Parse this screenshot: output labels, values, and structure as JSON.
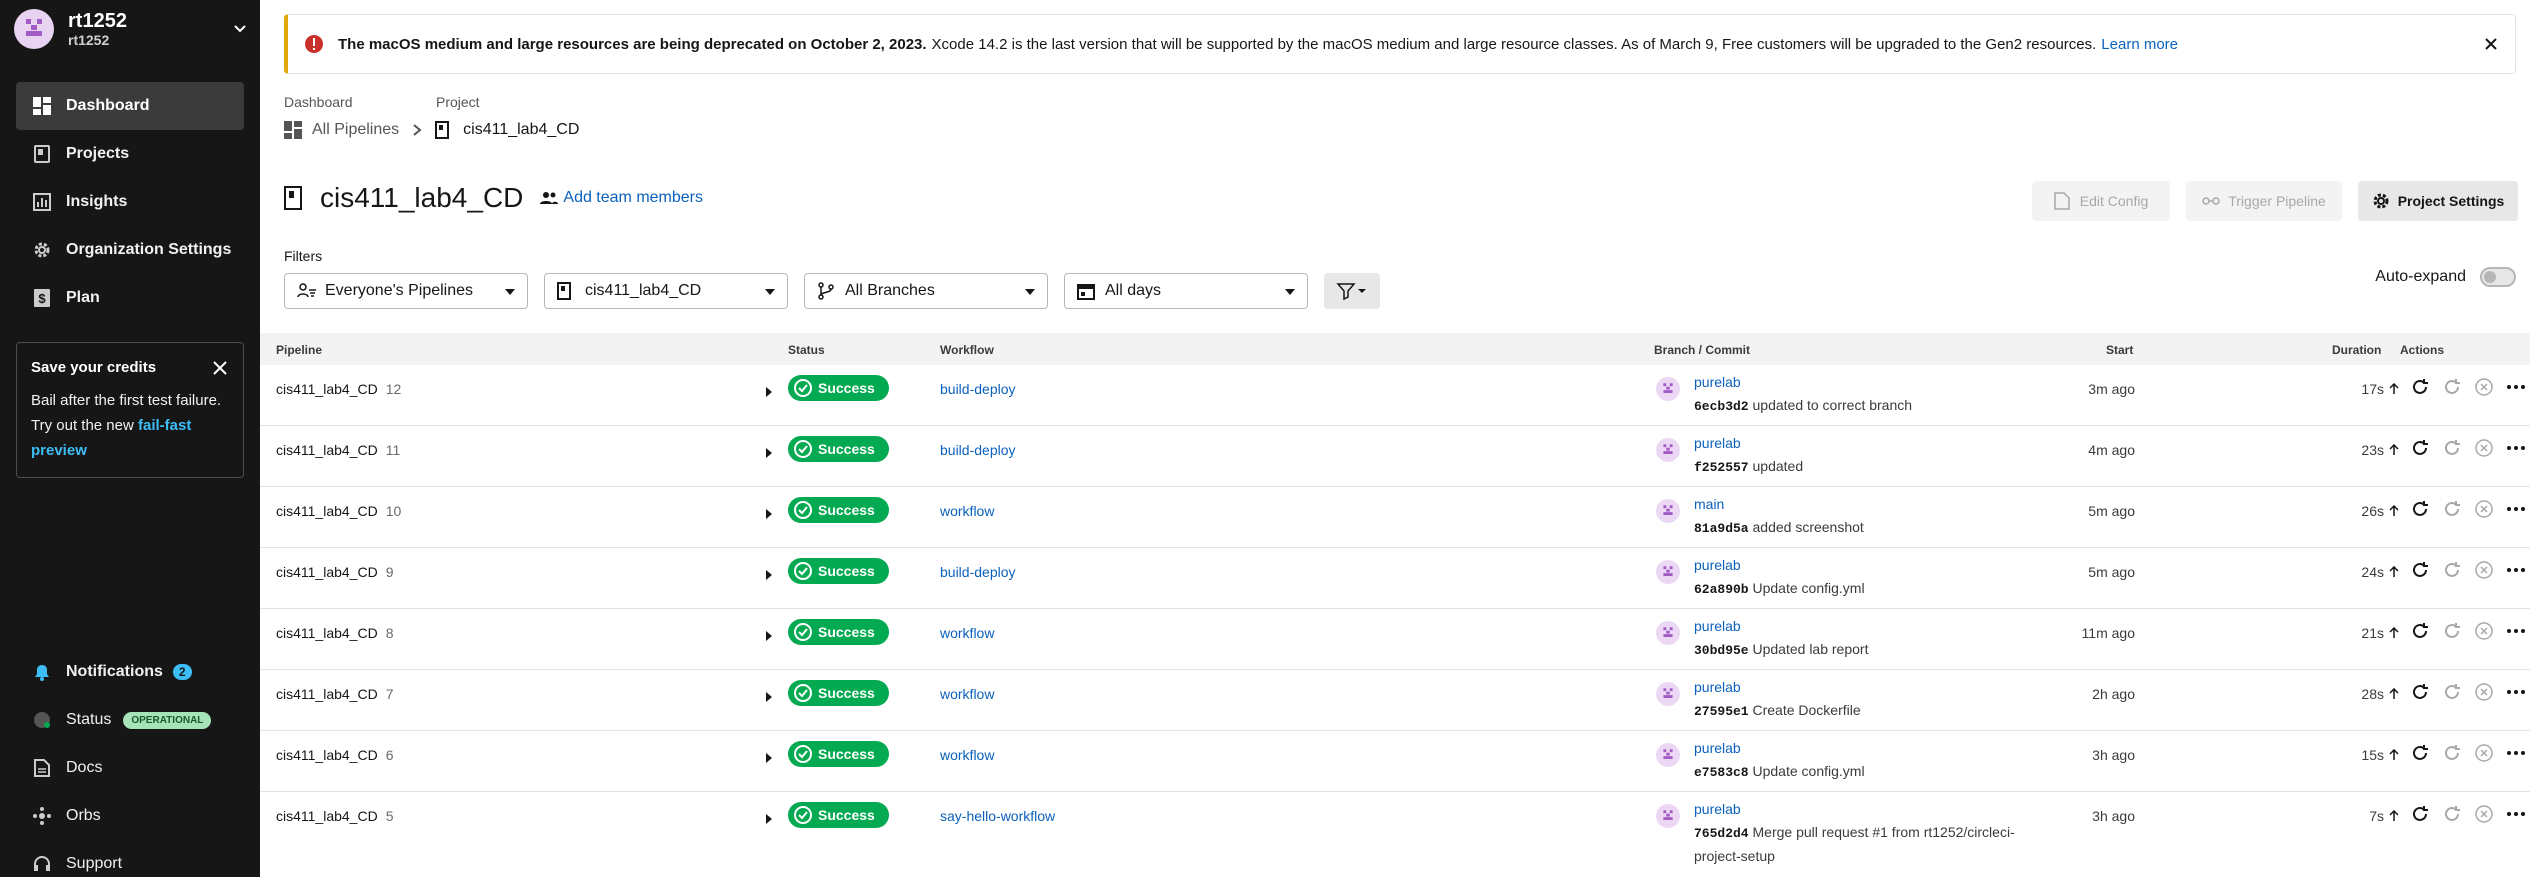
{
  "org": {
    "name": "rt1252",
    "sub": "rt1252"
  },
  "nav": [
    {
      "label": "Dashboard",
      "icon": "dashboard-icon",
      "active": true
    },
    {
      "label": "Projects",
      "icon": "projects-icon"
    },
    {
      "label": "Insights",
      "icon": "insights-icon"
    },
    {
      "label": "Organization Settings",
      "icon": "gear-icon"
    },
    {
      "label": "Plan",
      "icon": "dollar-icon"
    }
  ],
  "credits": {
    "title": "Save your credits",
    "text": "Bail after the first test failure. Try out the new",
    "link": "fail-fast preview"
  },
  "bottom_nav": {
    "notifications": "Notifications",
    "notifications_count": "2",
    "status": "Status",
    "status_badge": "OPERATIONAL",
    "docs": "Docs",
    "orbs": "Orbs",
    "support": "Support"
  },
  "banner": {
    "bold": "The macOS medium and large resources are being deprecated on October 2, 2023.",
    "text": "Xcode 14.2 is the last version that will be supported by the macOS medium and large resource classes. As of March 9, Free customers will be upgraded to the Gen2 resources.",
    "link": "Learn more"
  },
  "breadcrumb": {
    "label1": "Dashboard",
    "label2": "Project",
    "item1": "All Pipelines",
    "item2": "cis411_lab4_CD"
  },
  "title": "cis411_lab4_CD",
  "add_team": "Add team members",
  "buttons": {
    "edit_config": "Edit Config",
    "trigger": "Trigger Pipeline",
    "settings": "Project Settings"
  },
  "filters": {
    "label": "Filters",
    "pipelines": "Everyone's Pipelines",
    "project": "cis411_lab4_CD",
    "branches": "All Branches",
    "days": "All days",
    "auto_expand": "Auto-expand"
  },
  "columns": {
    "pipeline": "Pipeline",
    "status": "Status",
    "workflow": "Workflow",
    "branch": "Branch / Commit",
    "start": "Start",
    "duration": "Duration",
    "actions": "Actions"
  },
  "rows": [
    {
      "name": "cis411_lab4_CD",
      "num": "12",
      "status": "Success",
      "workflow": "build-deploy",
      "branch": "purelab",
      "sha": "6ecb3d2",
      "msg": "updated to correct branch",
      "start": "3m ago",
      "dur": "17s"
    },
    {
      "name": "cis411_lab4_CD",
      "num": "11",
      "status": "Success",
      "workflow": "build-deploy",
      "branch": "purelab",
      "sha": "f252557",
      "msg": "updated",
      "start": "4m ago",
      "dur": "23s"
    },
    {
      "name": "cis411_lab4_CD",
      "num": "10",
      "status": "Success",
      "workflow": "workflow",
      "branch": "main",
      "sha": "81a9d5a",
      "msg": "added screenshot",
      "start": "5m ago",
      "dur": "26s"
    },
    {
      "name": "cis411_lab4_CD",
      "num": "9",
      "status": "Success",
      "workflow": "build-deploy",
      "branch": "purelab",
      "sha": "62a890b",
      "msg": "Update config.yml",
      "start": "5m ago",
      "dur": "24s"
    },
    {
      "name": "cis411_lab4_CD",
      "num": "8",
      "status": "Success",
      "workflow": "workflow",
      "branch": "purelab",
      "sha": "30bd95e",
      "msg": "Updated lab report",
      "start": "11m ago",
      "dur": "21s"
    },
    {
      "name": "cis411_lab4_CD",
      "num": "7",
      "status": "Success",
      "workflow": "workflow",
      "branch": "purelab",
      "sha": "27595e1",
      "msg": "Create Dockerfile",
      "start": "2h ago",
      "dur": "28s"
    },
    {
      "name": "cis411_lab4_CD",
      "num": "6",
      "status": "Success",
      "workflow": "workflow",
      "branch": "purelab",
      "sha": "e7583c8",
      "msg": "Update config.yml",
      "start": "3h ago",
      "dur": "15s"
    },
    {
      "name": "cis411_lab4_CD",
      "num": "5",
      "status": "Success",
      "workflow": "say-hello-workflow",
      "branch": "purelab",
      "sha": "765d2d4",
      "msg": "Merge pull request #1 from rt1252/circleci-",
      "msg2": "project-setup",
      "start": "3h ago",
      "dur": "7s"
    }
  ],
  "colors": {
    "success": "#04aa51",
    "link": "#0b61bc",
    "sidebar": "#161616",
    "warning": "#e0a80d"
  }
}
